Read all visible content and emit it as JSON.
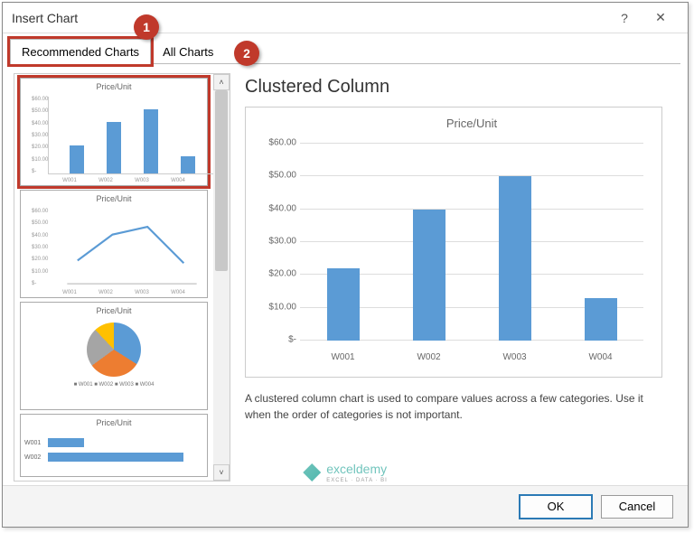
{
  "window": {
    "title": "Insert Chart"
  },
  "tabs": {
    "recommended": "Recommended Charts",
    "all": "All Charts"
  },
  "callouts": {
    "one": "1",
    "two": "2"
  },
  "chart_type_heading": "Clustered Column",
  "description": "A clustered column chart is used to compare values across a few categories. Use it when the order of categories is not important.",
  "buttons": {
    "ok": "OK",
    "cancel": "Cancel"
  },
  "watermark": {
    "brand": "exceldemy",
    "tagline": "EXCEL · DATA · BI"
  },
  "thumbs": {
    "t0_title": "Price/Unit",
    "t1_title": "Price/Unit",
    "t2_title": "Price/Unit",
    "t3_title": "Price/Unit",
    "pie_legend": "■ W001  ■ W002  ■ W003  ■ W004",
    "hb_w001": "W001",
    "hb_w002": "W002"
  },
  "chart_data": {
    "type": "bar",
    "title": "Price/Unit",
    "categories": [
      "W001",
      "W002",
      "W003",
      "W004"
    ],
    "values": [
      22,
      40,
      50,
      13
    ],
    "y_ticks": [
      "$-",
      "$10.00",
      "$20.00",
      "$30.00",
      "$40.00",
      "$50.00",
      "$60.00"
    ],
    "ylim": [
      0,
      60
    ],
    "xlabel": "",
    "ylabel": ""
  }
}
